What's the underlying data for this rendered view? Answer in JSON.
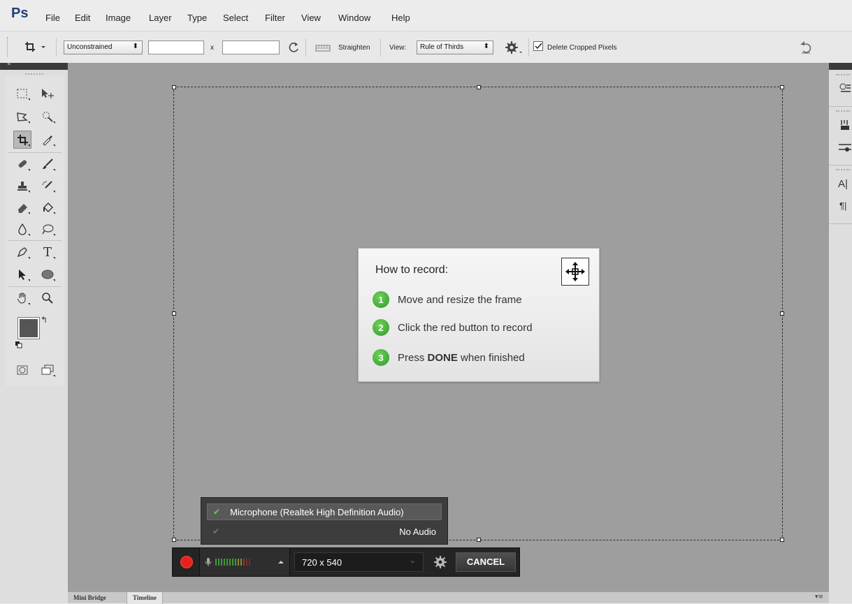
{
  "app": {
    "logo": "Ps"
  },
  "menu": [
    "File",
    "Edit",
    "Image",
    "Layer",
    "Type",
    "Select",
    "Filter",
    "View",
    "Window",
    "Help"
  ],
  "options_bar": {
    "ratio": "Unconstrained",
    "width_value": "",
    "height_value": "",
    "x_sep": "x",
    "straighten_label": "Straighten",
    "view_label": "View:",
    "view_value": "Rule of Thirds",
    "delete_cropped_label": "Delete Cropped Pixels",
    "delete_cropped_checked": true
  },
  "howto": {
    "title": "How to record:",
    "steps": [
      {
        "num": "1",
        "text": "Move and resize the frame"
      },
      {
        "num": "2",
        "text": "Click the red button to record"
      },
      {
        "num": "3",
        "pre": "Press ",
        "bold": "DONE",
        "post": " when finished"
      }
    ]
  },
  "audio_menu": {
    "items": [
      {
        "label": "Microphone (Realtek High Definition Audio)",
        "checked": true
      },
      {
        "label": "No Audio",
        "checked": false
      }
    ]
  },
  "record_bar": {
    "size": "720 x 540",
    "cancel_label": "CANCEL"
  },
  "bottom_tabs": [
    "Mini Bridge",
    "Timeline"
  ],
  "right_panel": {
    "text_a": "A|",
    "text_para": "¶|"
  },
  "colors": {
    "accent": "#1f3f7a",
    "record": "#e8211b",
    "step_green": "#3aa835",
    "canvas": "#9e9e9e"
  }
}
